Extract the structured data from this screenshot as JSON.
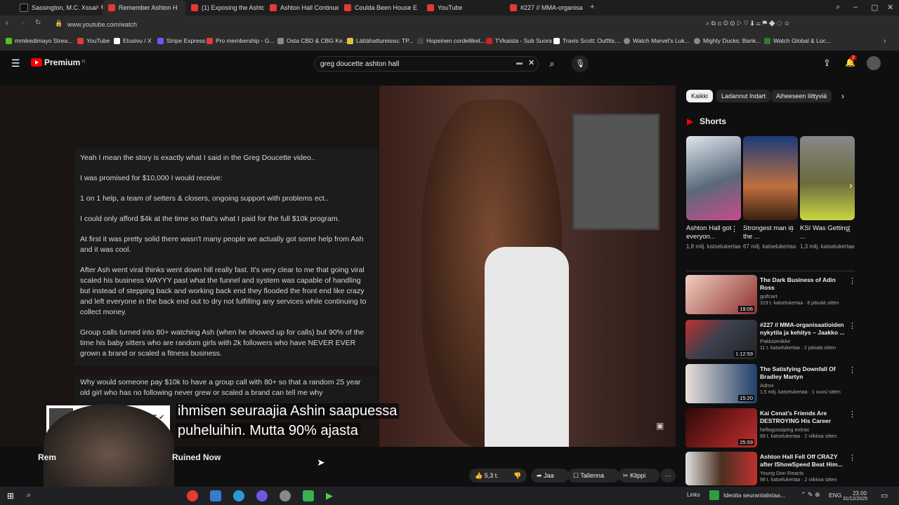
{
  "tabs": [
    {
      "label": "Sassington, M.C. Xssai¹ 🎨",
      "color": "#ffffff"
    },
    {
      "label": "Remember Ashton H",
      "color": "#e53935"
    },
    {
      "label": "(1) Exposing the Ashton H",
      "color": "#e53935"
    },
    {
      "label": "Ashton Hall Continues Th",
      "color": "#e53935"
    },
    {
      "label": "Coulda Been House Episo",
      "color": "#e53935"
    },
    {
      "label": "YouTube",
      "color": "#e53935"
    },
    {
      "label": "#227 // MMA-organisaati",
      "color": "#e53935"
    }
  ],
  "url": "www.youtube.com/watch",
  "bookmarks": [
    {
      "label": "mmikedimayo Strea...",
      "color": "#53c21b"
    },
    {
      "label": "YouTube",
      "color": "#e53935"
    },
    {
      "label": "Etusivu / X",
      "color": "#ffffff"
    },
    {
      "label": "Stripe Express",
      "color": "#635bff"
    },
    {
      "label": "Pro membership - G...",
      "color": "#e53935"
    },
    {
      "label": "Osta CBD & CBG Ke...",
      "color": "#888888"
    },
    {
      "label": "Lättähattureissu: TP...",
      "color": "#e0c040"
    },
    {
      "label": "Hopeinen cordelliket...",
      "color": "#444444"
    },
    {
      "label": "TVkaista - Sub Suora",
      "color": "#cc2222"
    },
    {
      "label": "Travis Scott: Outfits,...",
      "color": "#ffffff"
    },
    {
      "label": "Watch Marvel's Luk...",
      "color": "#888888"
    },
    {
      "label": "Mighty Ducks: Bank...",
      "color": "#888888"
    },
    {
      "label": "Watch Global & Loc...",
      "color": "#2e7d32"
    }
  ],
  "header": {
    "logo": "Premium",
    "logo_sup": "FI",
    "search_value": "greg doucette ashton hall",
    "notif_count": "2"
  },
  "video": {
    "card": [
      "Yeah I mean the story is exactly what I said in the Greg Doucette video..",
      "I was promised for $10,000 I would receive:",
      "1 on 1 help, a team of setters & closers, ongoing support with problems ect..",
      "I could only afford $4k at the time so that's what I paid for the full $10k program.",
      "At first it was pretty solid there wasn't many people we actually got some help from Ash and it was cool.",
      "After Ash went viral thinks went down hill really fast. It's very clear to me that going viral scaled his business WAYYY past what the funnel and system was capable of handling but instead of stepping back and working back end they flooded the front end like crazy and left everyone in the back end out to dry not fulfilling any services while continuing to collect money.",
      "Group calls turned into 80+ watching Ash (when he showed up for calls) but 90% of the time his baby sitters who are random girls with 2k followers who have NEVER EVER grown a brand or scaled a fitness business."
    ],
    "card2": "Why would someone pay $10k to have a group call with 80+ so that a random 25 year old girl who has no following never grew or scaled a brand can tell me why",
    "subtitle_line1": "ihmisen seuraajia Ashin saapuessa",
    "subtitle_line2": "puheluihin.  Mutta 90% ajasta",
    "overlay_name": "EVE",
    "title_left": "Rem",
    "title_right": "Ruined Now"
  },
  "actions": {
    "likes": "5,3 t.",
    "share": "Jaa",
    "save": "Tallenna",
    "clip": "Klippi"
  },
  "sidebar": {
    "chips": [
      "Kaikki",
      "Ladannut Indart",
      "Aiheeseen liittyviä"
    ],
    "shorts_label": "Shorts",
    "shorts": [
      {
        "title": "Ashton Hall got everyon...",
        "views": "1,8 milj. katselukertaa",
        "color": "#5a6a7a"
      },
      {
        "title": "Strongest man in the ...",
        "views": "67 milj. katselukertaa",
        "color": "#1a3a7a"
      },
      {
        "title": "KSI Was Getting ...",
        "views": "1,3 milj. katselukertaa",
        "color": "#6a6a40"
      }
    ],
    "videos": [
      {
        "title": "The Dark Business of Adin Ross",
        "channel": "golfcart",
        "meta": "319 t. katselukertaa · 8 päivää sitten",
        "duration": "19:06",
        "color": "#8a3030"
      },
      {
        "title": "#227 // MMA-organisaatioiden nykytila ja kehitys – Jaakko ...",
        "channel": "Pakkisimikke",
        "meta": "11 t. katselukertaa · 2 päivää sitten",
        "duration": "1:12:59",
        "color": "#3a4050"
      },
      {
        "title": "The Satisfying Downfall Of Bradley Martyn",
        "channel": "Adrox",
        "meta": "1,5 milj. katselukertaa · 1 vuosi sitten",
        "duration": "15:20",
        "color": "#20406a"
      },
      {
        "title": "Kai Cenat's Friends Are DESTROYING His Career",
        "channel": "hellogossiping extras",
        "meta": "69 t. katselukertaa · 2 viikkoa sitten",
        "duration": "25:59",
        "color": "#7a1a1a"
      },
      {
        "title": "Ashton Hall Fell Off CRAZY after IShowSpeed Beat Him...",
        "channel": "Young Don Reacts",
        "meta": "98 t. katselukertaa · 2 viikkoa sitten",
        "duration": "",
        "color": "#4a3020"
      }
    ]
  },
  "taskbar": {
    "weather": "Ideoita seurantalistaa...",
    "links": "Links",
    "lang": "ENG",
    "time": "23.00",
    "date": "31/12/2025"
  }
}
